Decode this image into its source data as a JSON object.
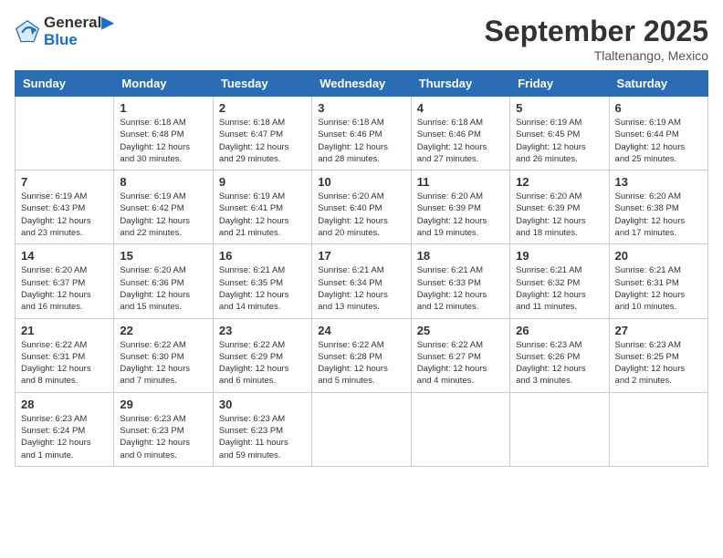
{
  "header": {
    "logo_line1": "General",
    "logo_line2": "Blue",
    "month_title": "September 2025",
    "location": "Tlaltenango, Mexico"
  },
  "columns": [
    "Sunday",
    "Monday",
    "Tuesday",
    "Wednesday",
    "Thursday",
    "Friday",
    "Saturday"
  ],
  "weeks": [
    [
      {
        "day": "",
        "info": ""
      },
      {
        "day": "1",
        "info": "Sunrise: 6:18 AM\nSunset: 6:48 PM\nDaylight: 12 hours\nand 30 minutes."
      },
      {
        "day": "2",
        "info": "Sunrise: 6:18 AM\nSunset: 6:47 PM\nDaylight: 12 hours\nand 29 minutes."
      },
      {
        "day": "3",
        "info": "Sunrise: 6:18 AM\nSunset: 6:46 PM\nDaylight: 12 hours\nand 28 minutes."
      },
      {
        "day": "4",
        "info": "Sunrise: 6:18 AM\nSunset: 6:46 PM\nDaylight: 12 hours\nand 27 minutes."
      },
      {
        "day": "5",
        "info": "Sunrise: 6:19 AM\nSunset: 6:45 PM\nDaylight: 12 hours\nand 26 minutes."
      },
      {
        "day": "6",
        "info": "Sunrise: 6:19 AM\nSunset: 6:44 PM\nDaylight: 12 hours\nand 25 minutes."
      }
    ],
    [
      {
        "day": "7",
        "info": "Sunrise: 6:19 AM\nSunset: 6:43 PM\nDaylight: 12 hours\nand 23 minutes."
      },
      {
        "day": "8",
        "info": "Sunrise: 6:19 AM\nSunset: 6:42 PM\nDaylight: 12 hours\nand 22 minutes."
      },
      {
        "day": "9",
        "info": "Sunrise: 6:19 AM\nSunset: 6:41 PM\nDaylight: 12 hours\nand 21 minutes."
      },
      {
        "day": "10",
        "info": "Sunrise: 6:20 AM\nSunset: 6:40 PM\nDaylight: 12 hours\nand 20 minutes."
      },
      {
        "day": "11",
        "info": "Sunrise: 6:20 AM\nSunset: 6:39 PM\nDaylight: 12 hours\nand 19 minutes."
      },
      {
        "day": "12",
        "info": "Sunrise: 6:20 AM\nSunset: 6:39 PM\nDaylight: 12 hours\nand 18 minutes."
      },
      {
        "day": "13",
        "info": "Sunrise: 6:20 AM\nSunset: 6:38 PM\nDaylight: 12 hours\nand 17 minutes."
      }
    ],
    [
      {
        "day": "14",
        "info": "Sunrise: 6:20 AM\nSunset: 6:37 PM\nDaylight: 12 hours\nand 16 minutes."
      },
      {
        "day": "15",
        "info": "Sunrise: 6:20 AM\nSunset: 6:36 PM\nDaylight: 12 hours\nand 15 minutes."
      },
      {
        "day": "16",
        "info": "Sunrise: 6:21 AM\nSunset: 6:35 PM\nDaylight: 12 hours\nand 14 minutes."
      },
      {
        "day": "17",
        "info": "Sunrise: 6:21 AM\nSunset: 6:34 PM\nDaylight: 12 hours\nand 13 minutes."
      },
      {
        "day": "18",
        "info": "Sunrise: 6:21 AM\nSunset: 6:33 PM\nDaylight: 12 hours\nand 12 minutes."
      },
      {
        "day": "19",
        "info": "Sunrise: 6:21 AM\nSunset: 6:32 PM\nDaylight: 12 hours\nand 11 minutes."
      },
      {
        "day": "20",
        "info": "Sunrise: 6:21 AM\nSunset: 6:31 PM\nDaylight: 12 hours\nand 10 minutes."
      }
    ],
    [
      {
        "day": "21",
        "info": "Sunrise: 6:22 AM\nSunset: 6:31 PM\nDaylight: 12 hours\nand 8 minutes."
      },
      {
        "day": "22",
        "info": "Sunrise: 6:22 AM\nSunset: 6:30 PM\nDaylight: 12 hours\nand 7 minutes."
      },
      {
        "day": "23",
        "info": "Sunrise: 6:22 AM\nSunset: 6:29 PM\nDaylight: 12 hours\nand 6 minutes."
      },
      {
        "day": "24",
        "info": "Sunrise: 6:22 AM\nSunset: 6:28 PM\nDaylight: 12 hours\nand 5 minutes."
      },
      {
        "day": "25",
        "info": "Sunrise: 6:22 AM\nSunset: 6:27 PM\nDaylight: 12 hours\nand 4 minutes."
      },
      {
        "day": "26",
        "info": "Sunrise: 6:23 AM\nSunset: 6:26 PM\nDaylight: 12 hours\nand 3 minutes."
      },
      {
        "day": "27",
        "info": "Sunrise: 6:23 AM\nSunset: 6:25 PM\nDaylight: 12 hours\nand 2 minutes."
      }
    ],
    [
      {
        "day": "28",
        "info": "Sunrise: 6:23 AM\nSunset: 6:24 PM\nDaylight: 12 hours\nand 1 minute."
      },
      {
        "day": "29",
        "info": "Sunrise: 6:23 AM\nSunset: 6:23 PM\nDaylight: 12 hours\nand 0 minutes."
      },
      {
        "day": "30",
        "info": "Sunrise: 6:23 AM\nSunset: 6:23 PM\nDaylight: 11 hours\nand 59 minutes."
      },
      {
        "day": "",
        "info": ""
      },
      {
        "day": "",
        "info": ""
      },
      {
        "day": "",
        "info": ""
      },
      {
        "day": "",
        "info": ""
      }
    ]
  ]
}
